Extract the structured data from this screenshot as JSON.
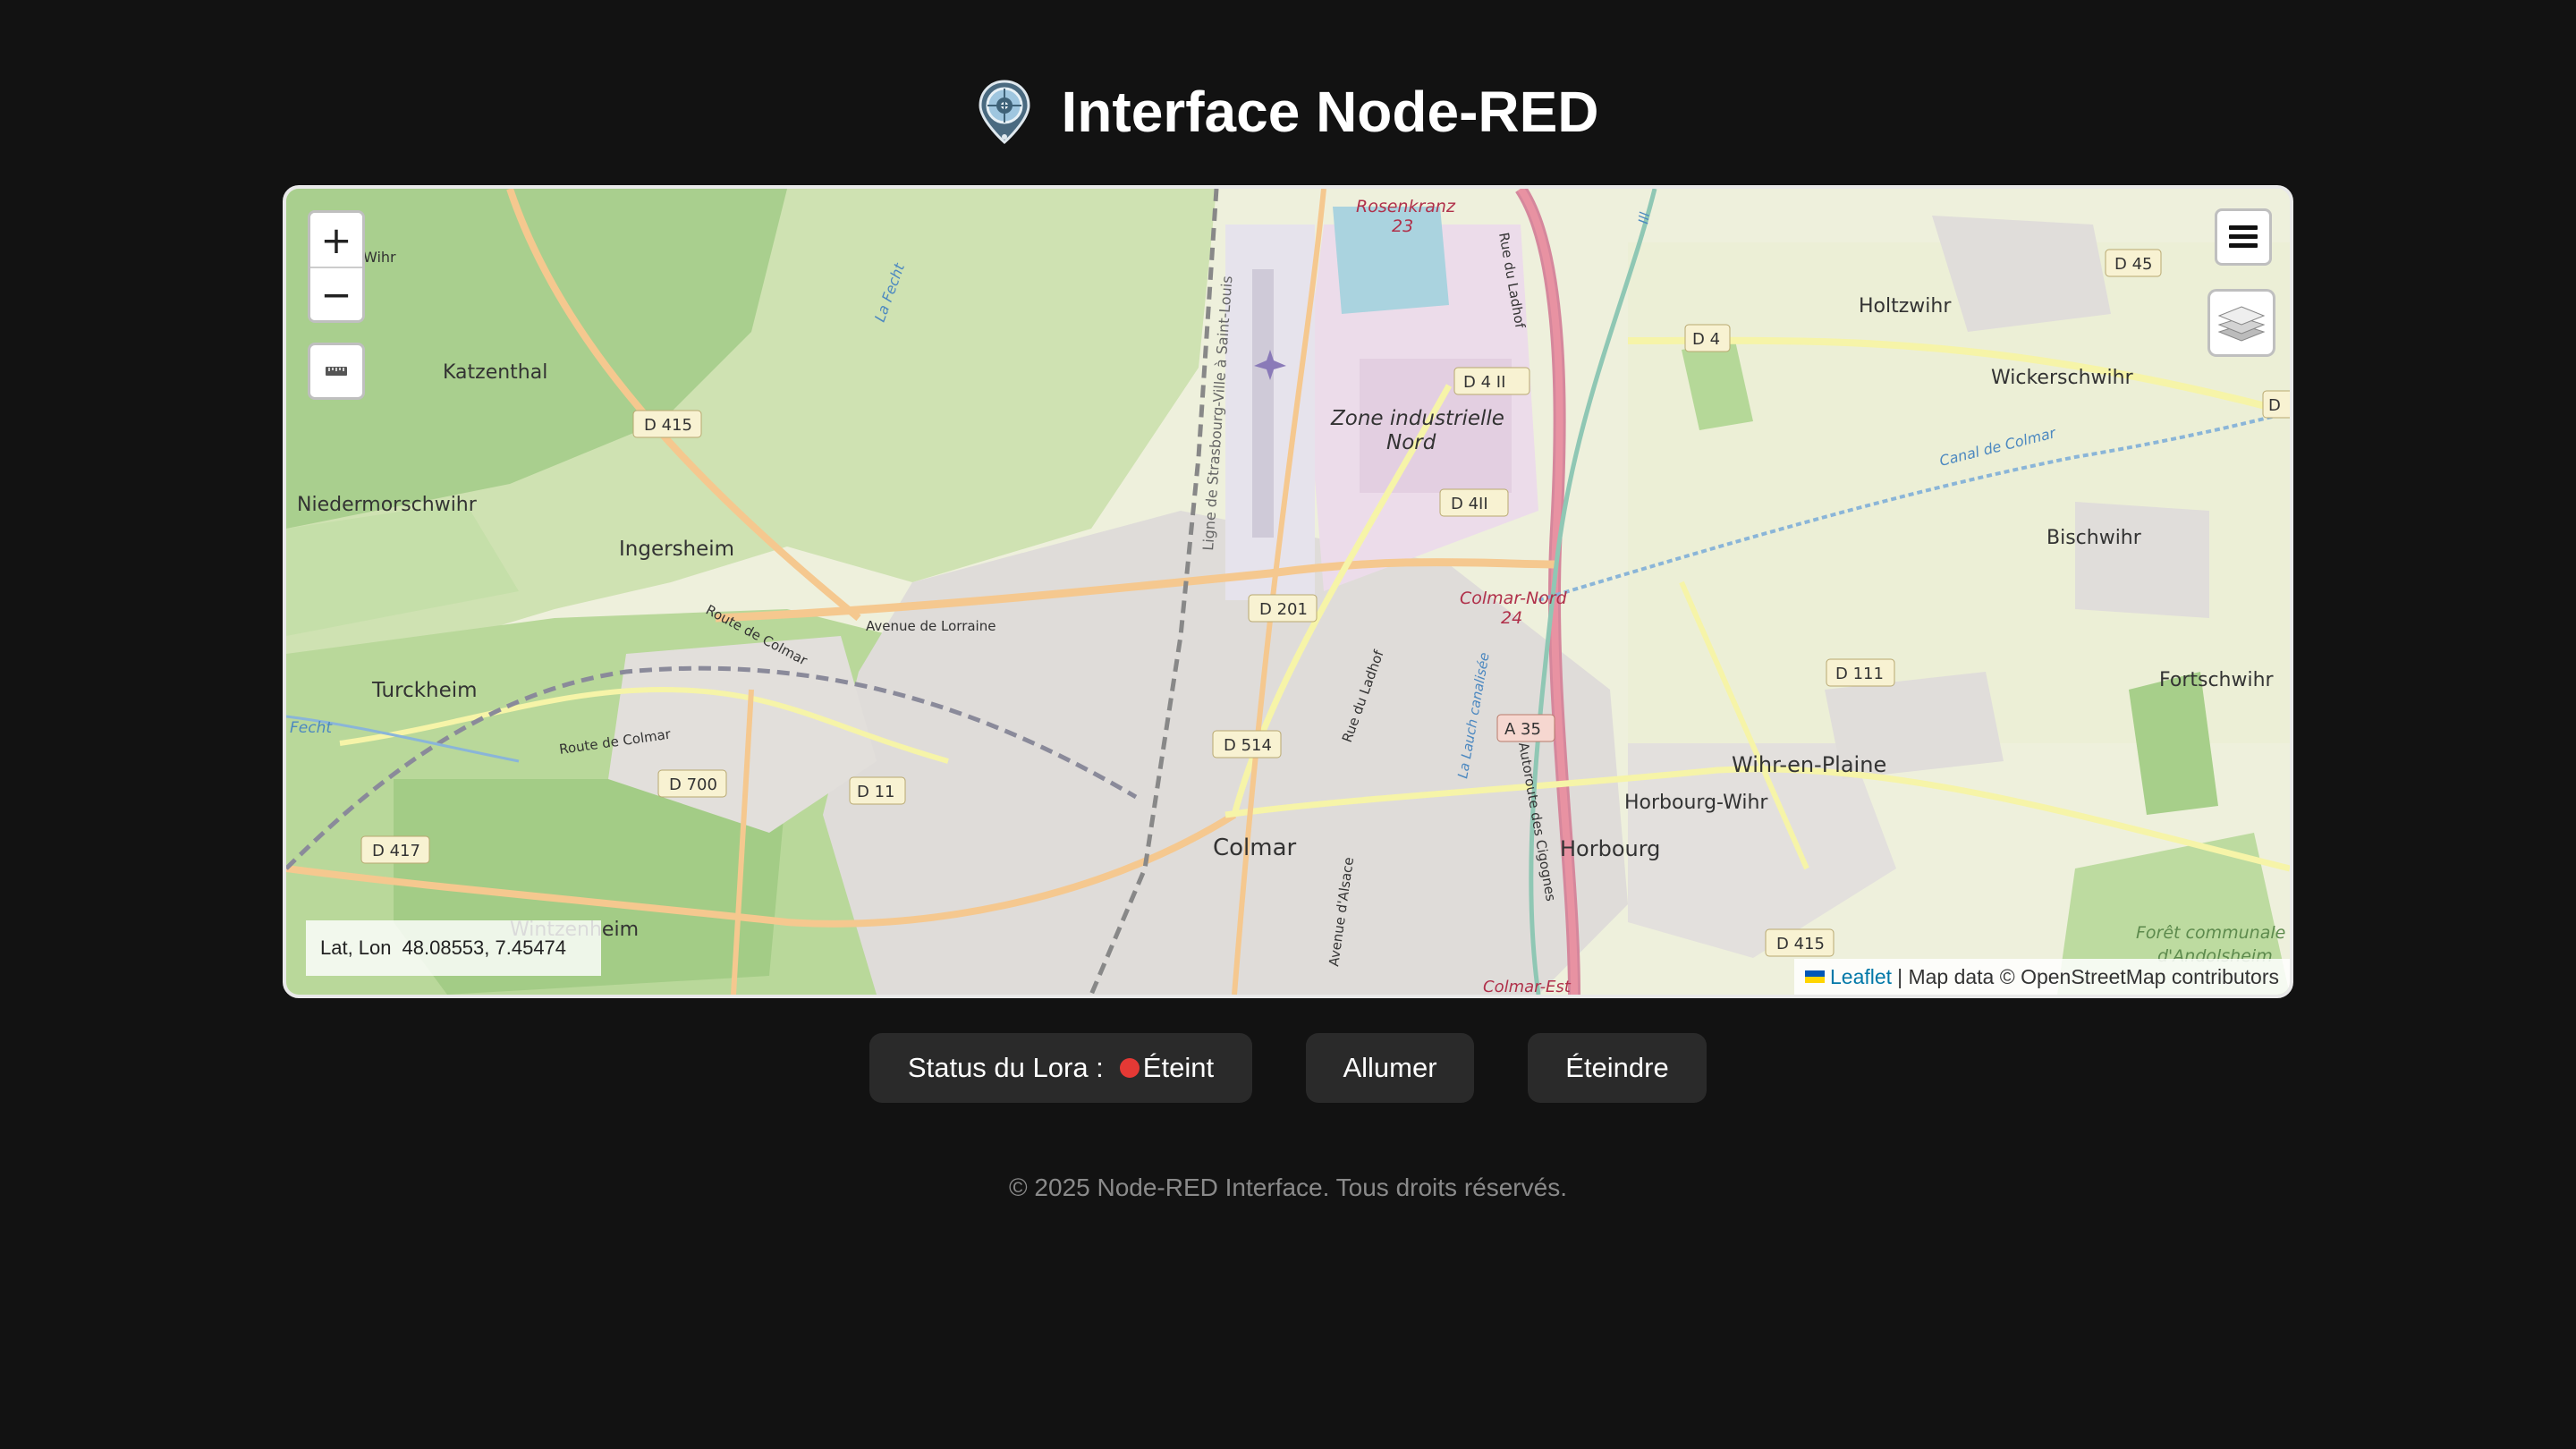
{
  "header": {
    "title": "Interface Node-RED",
    "icon": "map-pin-icon"
  },
  "map": {
    "zoom_in_label": "+",
    "zoom_out_label": "−",
    "coords_label": "Lat, Lon",
    "coords_value": "48.08553, 7.45474",
    "attribution_link": "Leaflet",
    "attribution_text": "| Map data © OpenStreetMap contributors",
    "places": {
      "katzenthal": "Katzenthal",
      "niedermorschwihr": "Niedermorschwihr",
      "ingersheim": "Ingersheim",
      "turckheim": "Turckheim",
      "wintzenheim": "Wintzenheim",
      "colmar": "Colmar",
      "horbourg": "Horbourg",
      "horbourg_wihr": "Horbourg-Wihr",
      "wihr_en_plaine": "Wihr-en-Plaine",
      "holtzwihr": "Holtzwihr",
      "wickerschwihr": "Wickerschwihr",
      "bischwihr": "Bischwihr",
      "fortschwihr": "Fortschwihr",
      "zone_line1": "Zone industrielle",
      "zone_line2": "Nord",
      "rosenkranz": "Rosenkranz",
      "rosenkranz_no": "23",
      "colmar_nord": "Colmar-Nord",
      "colmar_nord_no": "24",
      "colmar_est": "Colmar-Est",
      "foret": "Forêt communale",
      "foret2": "d'Andolsheim"
    },
    "roads": {
      "d415": "D 415",
      "d201": "D 201",
      "d4ii_a": "D 4 II",
      "d4ii_b": "D 4II",
      "d4": "D 4",
      "d45": "D 45",
      "d111": "D 111",
      "a35": "A 35",
      "d514": "D 514",
      "d700": "D 700",
      "d11": "D 11",
      "d417": "D 417",
      "d415_b": "D 415",
      "d_edge": "D"
    },
    "streets": {
      "avenue_lorraine": "Avenue de Lorraine",
      "route_colmar": "Route de Colmar",
      "route_colmar2": "Route de Colmar",
      "rue_ladhof": "Rue du Ladhof",
      "rue_ladhof2": "Rue du Ladhof",
      "ligne": "Ligne de Strasbourg-Ville à Saint-Louis",
      "autoroute": "Autoroute des Cigognes",
      "canal": "Canal de Colmar",
      "lauch": "La Lauch canalisée",
      "avenue_alsace": "Avenue d'Alsace",
      "fecht": "La Fecht",
      "fecht2": "Fecht",
      "ill": "Ill",
      "wihr": "Wihr"
    }
  },
  "controls": {
    "status_label": "Status du Lora :",
    "status_value": "Éteint",
    "status_color": "#e53935",
    "on_label": "Allumer",
    "off_label": "Éteindre"
  },
  "footer": {
    "text": "© 2025 Node-RED Interface. Tous droits réservés."
  }
}
